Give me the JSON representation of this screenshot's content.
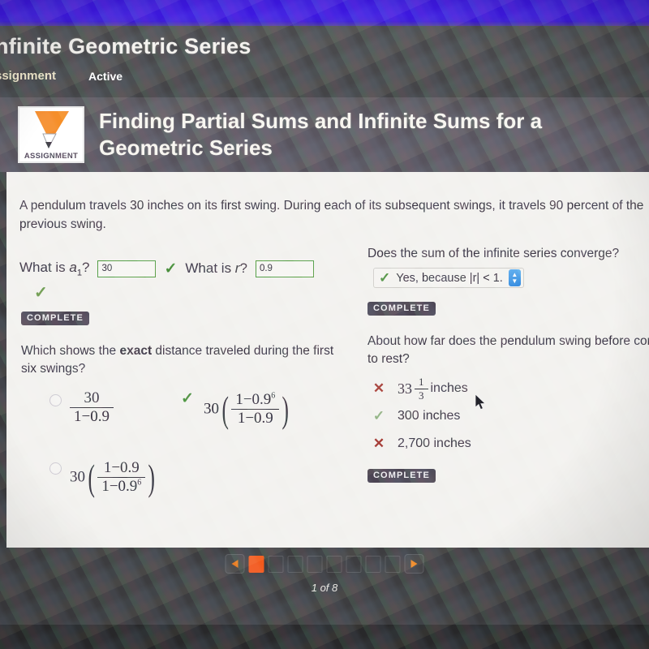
{
  "chrome": {
    "course_title": "nfinite Geometric Series",
    "tab_assignment": "ssignment",
    "tab_active": "Active"
  },
  "assignment": {
    "badge_label": "ASSIGNMENT",
    "badge_icon": "pencil-icon",
    "title": "Finding Partial Sums and Infinite Sums for a Geometric Series"
  },
  "content": {
    "prompt": "A pendulum travels 30 inches on its first swing. During each of its subsequent swings, it travels 90 percent of the previous swing.",
    "q1": {
      "label_a1_pre": "What is ",
      "label_a1_var": "a",
      "label_a1_sub": "1",
      "label_a1_post": "?",
      "a1_value": "30",
      "a1_check": "✓",
      "label_r_pre": "What is ",
      "label_r_var": "r",
      "label_r_post": "?",
      "r_value": "0.9",
      "standalone_check": "✓",
      "complete_badge": "COMPLETE"
    },
    "q2": {
      "question": "Does the sum of the infinite series converge?",
      "selected_option": "Yes, because |r| < 1.",
      "select_check": "✓",
      "stepper_icon": "stepper-updown-icon",
      "complete_badge": "COMPLETE"
    },
    "q3": {
      "question_pre": "Which shows the ",
      "question_bold": "exact",
      "question_post": " distance traveled during the first six swings?",
      "options": [
        {
          "id": "option-a",
          "coefficient": "",
          "numerator": "30",
          "denominator": "1−0.9",
          "parens": false,
          "state": "unselected",
          "mark": ""
        },
        {
          "id": "option-b",
          "coefficient": "30",
          "numerator": "1−0.9",
          "numerator_exp": "6",
          "denominator": "1−0.9",
          "parens": true,
          "state": "correct",
          "mark": "✓"
        },
        {
          "id": "option-c",
          "coefficient": "30",
          "numerator": "1−0.9",
          "denominator": "1−0.9",
          "denominator_exp": "6",
          "parens": true,
          "state": "unselected",
          "mark": ""
        }
      ]
    },
    "q4": {
      "question": "About how far does the pendulum swing before coming to rest?",
      "answers": [
        {
          "mark": "✕",
          "state": "incorrect",
          "whole": "33",
          "frac_num": "1",
          "frac_den": "3",
          "unit": "inches",
          "text": ""
        },
        {
          "mark": "✓",
          "state": "correct",
          "whole": "",
          "frac_num": "",
          "frac_den": "",
          "unit": "",
          "text": "300 inches"
        },
        {
          "mark": "✕",
          "state": "incorrect",
          "whole": "",
          "frac_num": "",
          "frac_den": "",
          "unit": "",
          "text": "2,700 inches"
        }
      ],
      "complete_badge": "COMPLETE"
    }
  },
  "footer": {
    "prev_icon": "triangle-left-icon",
    "next_icon": "triangle-right-icon",
    "pages": [
      "1",
      "2",
      "3",
      "4",
      "5",
      "6",
      "7",
      "8"
    ],
    "current_page_index": 0,
    "page_label": "1 of 8"
  },
  "colors": {
    "accent_orange": "#f2591b",
    "correct_green": "#4a8f3c",
    "incorrect_red": "#a3352c",
    "top_band_violet": "#3a16d8",
    "panel_bg": "#f2f1ee",
    "chrome_gray": "#48484b"
  }
}
